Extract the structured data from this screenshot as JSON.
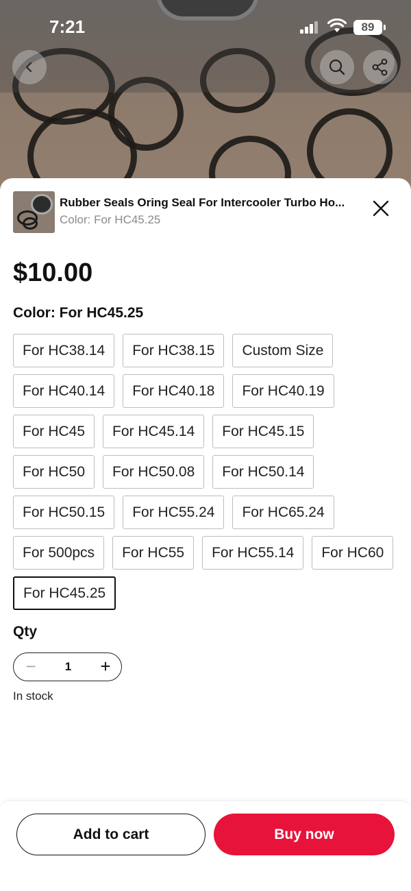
{
  "status_bar": {
    "time": "7:21",
    "battery": "89"
  },
  "nav": {
    "back_icon": "chevron-left-icon",
    "search_icon": "search-icon",
    "share_icon": "share-icon"
  },
  "product": {
    "title": "Rubber Seals Oring Seal For Intercooler Turbo Ho...",
    "subtitle": "Color: For HC45.25",
    "price": "$10.00"
  },
  "color": {
    "label": "Color: For HC45.25",
    "options": [
      {
        "label": "For HC38.14",
        "selected": false
      },
      {
        "label": "For HC38.15",
        "selected": false
      },
      {
        "label": "Custom Size",
        "selected": false
      },
      {
        "label": "For HC40.14",
        "selected": false
      },
      {
        "label": "For HC40.18",
        "selected": false
      },
      {
        "label": "For HC40.19",
        "selected": false
      },
      {
        "label": "For HC45",
        "selected": false
      },
      {
        "label": "For HC45.14",
        "selected": false
      },
      {
        "label": "For HC45.15",
        "selected": false
      },
      {
        "label": "For HC50",
        "selected": false
      },
      {
        "label": "For HC50.08",
        "selected": false
      },
      {
        "label": "For HC50.14",
        "selected": false
      },
      {
        "label": "For HC50.15",
        "selected": false
      },
      {
        "label": "For HC55.24",
        "selected": false
      },
      {
        "label": "For HC65.24",
        "selected": false
      },
      {
        "label": "For 500pcs",
        "selected": false
      },
      {
        "label": "For HC55",
        "selected": false
      },
      {
        "label": "For HC55.14",
        "selected": false
      },
      {
        "label": "For HC60",
        "selected": false
      },
      {
        "label": "For HC45.25",
        "selected": true
      }
    ]
  },
  "qty": {
    "label": "Qty",
    "value": "1",
    "minus": "−",
    "plus": "+"
  },
  "stock": "In stock",
  "actions": {
    "add_to_cart": "Add to cart",
    "buy_now": "Buy now"
  },
  "colors": {
    "accent": "#e8133a",
    "selected_border": "#111111"
  }
}
